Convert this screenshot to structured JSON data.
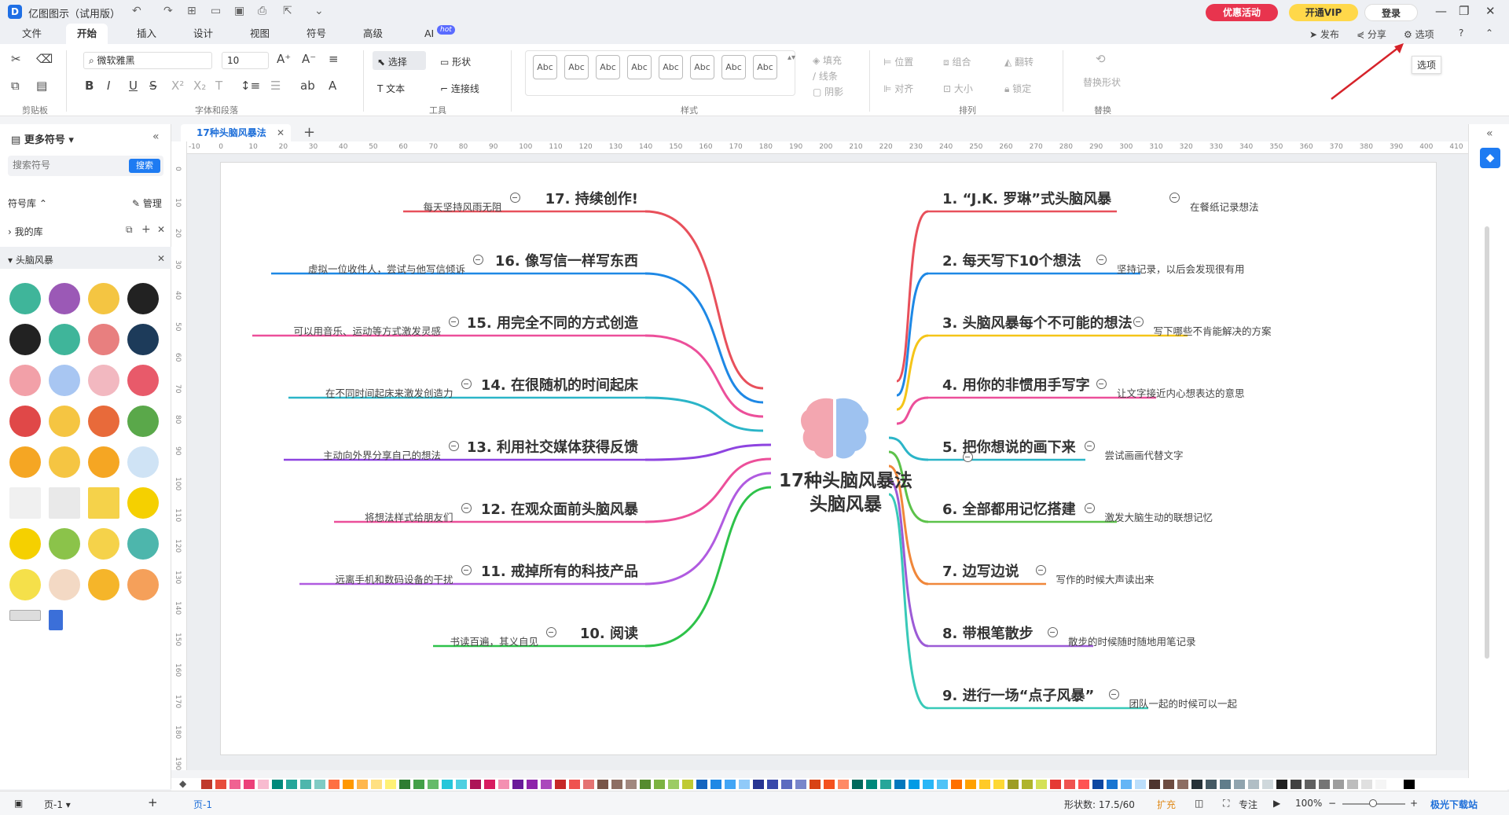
{
  "app": {
    "title": "亿图图示（试用版）"
  },
  "promo": {
    "deal": "优惠活动",
    "vip": "开通VIP",
    "login": "登录"
  },
  "menu": {
    "tabs": [
      "文件",
      "开始",
      "插入",
      "设计",
      "视图",
      "符号",
      "高级",
      "AI"
    ],
    "hot": "hot",
    "right": {
      "publish": "发布",
      "share": "分享",
      "options": "选项"
    }
  },
  "tooltip": "选项",
  "ribbon": {
    "font_name": "微软雅黑",
    "font_size": "10",
    "groups": {
      "clipboard": "剪贴板",
      "font": "字体和段落",
      "tools": "工具",
      "styles": "样式",
      "arrange": "排列",
      "replace": "替换"
    },
    "tools": {
      "select": "选择",
      "shape": "形状",
      "text": "文本",
      "connector": "连接线"
    },
    "style_sample": "Abc",
    "fill": "填充",
    "line": "线条",
    "shadow": "阴影",
    "position": "位置",
    "group": "组合",
    "flip": "翻转",
    "align": "对齐",
    "size": "大小",
    "lock": "锁定",
    "replace_shape": "替换形状"
  },
  "left_panel": {
    "title": "更多符号",
    "search_placeholder": "搜索符号",
    "search_btn": "搜索",
    "library": "符号库",
    "manage": "管理",
    "my_library": "我的库",
    "category": "头脑风暴"
  },
  "doc_tab": "17种头脑风暴法",
  "ruler_h": [
    "-10",
    "0",
    "10",
    "20",
    "30",
    "40",
    "50",
    "60",
    "70",
    "80",
    "90",
    "100",
    "110",
    "120",
    "130",
    "140",
    "150",
    "160",
    "170",
    "180",
    "190",
    "200",
    "210",
    "220",
    "230",
    "240",
    "250",
    "260",
    "270",
    "280",
    "290",
    "300",
    "310",
    "320",
    "330",
    "340",
    "350",
    "360",
    "370",
    "380",
    "390",
    "400",
    "410"
  ],
  "ruler_v": [
    "0",
    "10",
    "20",
    "30",
    "40",
    "50",
    "60",
    "70",
    "80",
    "90",
    "100",
    "110",
    "120",
    "130",
    "140",
    "150",
    "160",
    "170",
    "180",
    "190"
  ],
  "mindmap": {
    "center_line1": "17种头脑风暴法",
    "center_line2": "头脑风暴",
    "right": [
      {
        "title": "1.  “J.K. 罗琳”式头脑风暴",
        "note": "在餐纸记录想法",
        "color": "#e8505b"
      },
      {
        "title": "2. 每天写下10个想法",
        "note": "坚持记录，以后会发现很有用",
        "color": "#1e88e5"
      },
      {
        "title": "3. 头脑风暴每个不可能的想法",
        "note": "写下哪些不肯能解决的方案",
        "color": "#f5c518"
      },
      {
        "title": "4. 用你的非惯用手写字",
        "note": "让文字接近内心想表达的意思",
        "color": "#ec4f9a"
      },
      {
        "title": "5. 把你想说的画下来",
        "note": "尝试画画代替文字",
        "color": "#2bb5c8"
      },
      {
        "title": "6. 全部都用记忆搭建",
        "note": "激发大脑生动的联想记忆",
        "color": "#5cc24a"
      },
      {
        "title": "7. 边写边说",
        "note": "写作的时候大声读出来",
        "color": "#f0873a"
      },
      {
        "title": "8. 带根笔散步",
        "note": "散步的时候随时随地用笔记录",
        "color": "#9c5bd6"
      },
      {
        "title": "9. 进行一场“点子风暴”",
        "note": "团队一起的时候可以一起",
        "color": "#38c9b8"
      }
    ],
    "left": [
      {
        "title": "17. 持续创作!",
        "note": "每天坚持风雨无阻",
        "color": "#e8505b"
      },
      {
        "title": "16. 像写信一样写东西",
        "note": "虚拟一位收件人，尝试与他写信倾诉",
        "color": "#1e88e5"
      },
      {
        "title": "15. 用完全不同的方式创造",
        "note": "可以用音乐、运动等方式激发灵感",
        "color": "#ec4f9a"
      },
      {
        "title": "14. 在很随机的时间起床",
        "note": "在不同时间起床来激发创造力",
        "color": "#2bb5c8"
      },
      {
        "title": "13. 利用社交媒体获得反馈",
        "note": "主动向外界分享自己的想法",
        "color": "#8e44e0"
      },
      {
        "title": "12. 在观众面前头脑风暴",
        "note": "将想法样式给朋友们",
        "color": "#ec4f9a"
      },
      {
        "title": "11. 戒掉所有的科技产品",
        "note": "远离手机和数码设备的干扰",
        "color": "#b05be0"
      },
      {
        "title": "10. 阅读",
        "note": "书读百遍，其义自见",
        "color": "#2ec24a"
      }
    ]
  },
  "status": {
    "page_label": "页-1",
    "page_tab": "页-1",
    "shape_count": "形状数: 17.5/60",
    "expand": "扩充",
    "focus": "专注",
    "zoom": "100%"
  },
  "watermark": "极光下载站"
}
